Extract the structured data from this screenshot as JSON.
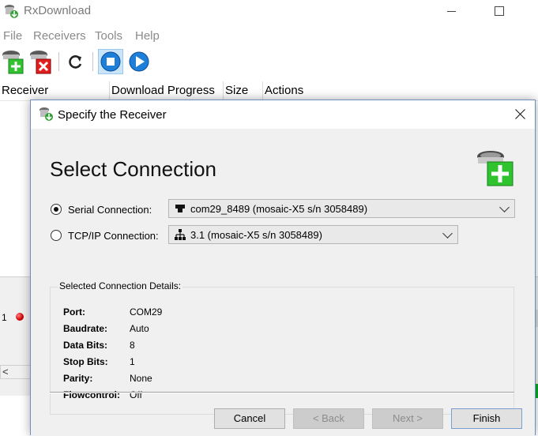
{
  "window": {
    "title": "RxDownload",
    "icon": "rxdownload-app-icon"
  },
  "menu": [
    "File",
    "Receivers",
    "Tools",
    "Help"
  ],
  "toolbar": {
    "add_receiver": "add-receiver-icon",
    "remove_receiver": "remove-receiver-icon",
    "refresh": "refresh-icon",
    "stop": "stop-icon",
    "play": "play-icon"
  },
  "table": {
    "columns": [
      "Receiver",
      "Download Progress",
      "Size",
      "Actions"
    ],
    "row_number": "1"
  },
  "dialog": {
    "title": "Specify the Receiver",
    "heading": "Select Connection",
    "serial": {
      "label": "Serial Connection:",
      "value": "com29_8489 (mosaic-X5 s/n 3058489)",
      "checked": true
    },
    "tcpip": {
      "label": "TCP/IP Connection:",
      "value": "3.1 (mosaic-X5 s/n 3058489)",
      "checked": false
    },
    "details_title": "Selected Connection Details:",
    "details": [
      {
        "key": "Port:",
        "value": "COM29"
      },
      {
        "key": "Baudrate:",
        "value": "Auto"
      },
      {
        "key": "Data Bits:",
        "value": "8"
      },
      {
        "key": "Stop Bits:",
        "value": "1"
      },
      {
        "key": "Parity:",
        "value": "None"
      },
      {
        "key": "Flowcontrol:",
        "value": "Off"
      }
    ],
    "buttons": {
      "cancel": "Cancel",
      "back": "< Back",
      "next": "Next >",
      "finish": "Finish"
    }
  },
  "colors": {
    "accent": "#0078d7",
    "status_green": "#06b025",
    "icon_green": "#2fc32f",
    "icon_red": "#e02020"
  }
}
